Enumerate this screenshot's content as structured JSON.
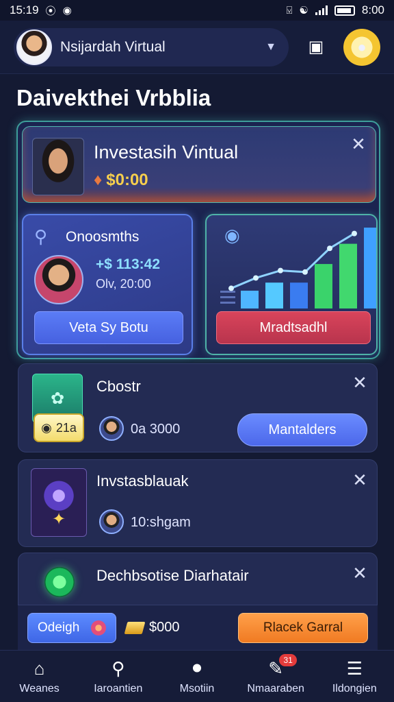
{
  "status": {
    "time": "15:19",
    "clock_right": "8:00"
  },
  "header": {
    "account_name": "Nsijardah Virtual"
  },
  "section_title": "Daivekthei Vrbblia",
  "hero": {
    "title": "Investasih Vintual",
    "amount": "$0:00",
    "left_card": {
      "title": "Onoosmths",
      "amount": "+$ 113:42",
      "date": "Olv, 20:00",
      "button": "Veta Sy Botu"
    },
    "right_card": {
      "button": "Mradtsadhl",
      "chart_bars": [
        0.22,
        0.32,
        0.32,
        0.55,
        0.8,
        1.0
      ],
      "chart_line": [
        0.18,
        0.32,
        0.42,
        0.4,
        0.72,
        0.92
      ]
    }
  },
  "rows": [
    {
      "title": "Cbostr",
      "badge": "21a",
      "meta": "0a 3000",
      "button": "Mantalders"
    },
    {
      "title": "Invstasblauak",
      "meta": "10:shgam"
    },
    {
      "title": "Dechbsotise Diarhatair"
    }
  ],
  "action_bar": {
    "left_button": "Odeigh",
    "gold_amount": "$000",
    "right_button": "Rlacek Garral"
  },
  "bottom_nav": [
    {
      "label": "Weanes",
      "icon": "home-icon"
    },
    {
      "label": "Iaroantien",
      "icon": "search-icon"
    },
    {
      "label": "Msotiin",
      "icon": "drop-icon"
    },
    {
      "label": "Nmaaraben",
      "icon": "edit-icon",
      "badge": "31"
    },
    {
      "label": "Ildongien",
      "icon": "menu-icon"
    }
  ]
}
